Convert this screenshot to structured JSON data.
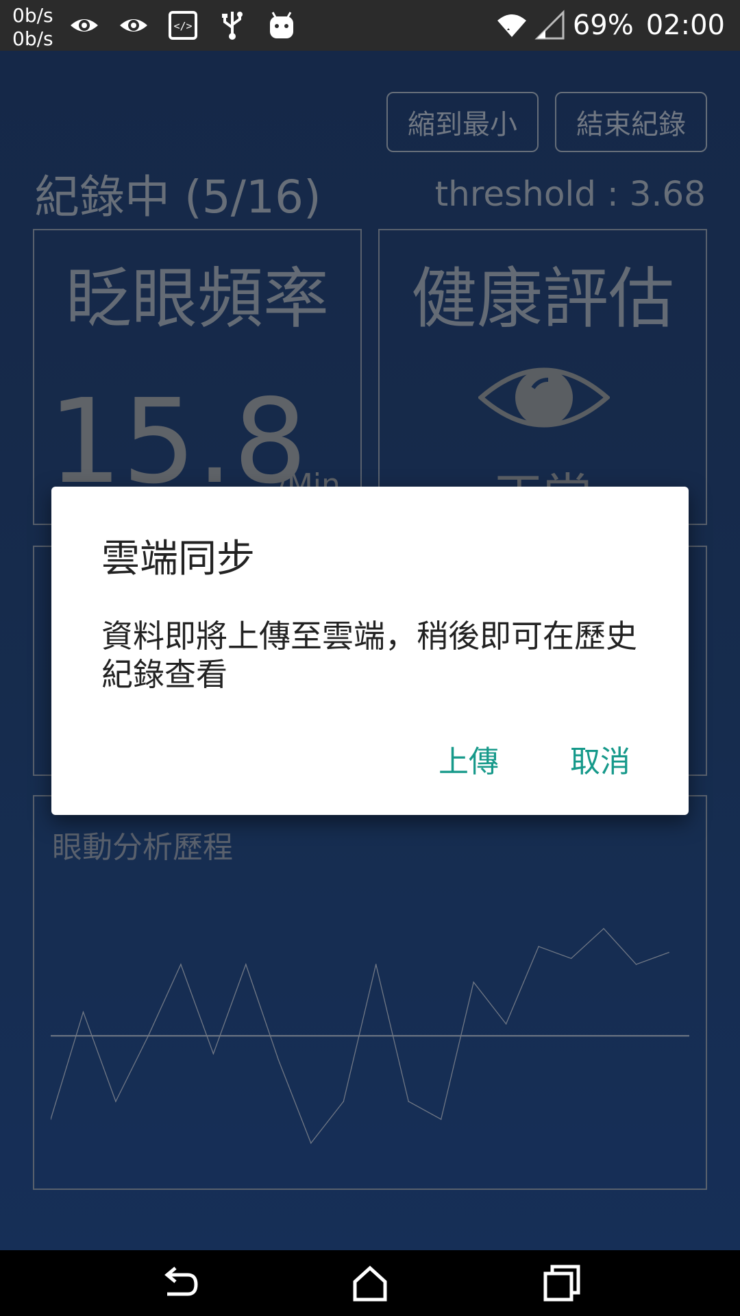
{
  "status_bar": {
    "net_up": "0b/s",
    "net_down": "0b/s",
    "battery": "69%",
    "time": "02:00",
    "icons": [
      "eye-icon",
      "eye-icon",
      "code-icon",
      "usb-icon",
      "android-icon",
      "wifi-icon",
      "signal-icon"
    ]
  },
  "header": {
    "minimize_label": "縮到最小",
    "end_label": "結束紀錄",
    "recording_status": "紀錄中 (5/16)",
    "threshold": "threshold : 3.68"
  },
  "panels": {
    "blink": {
      "title": "眨眼頻率",
      "value": "15.8",
      "unit": "/Min"
    },
    "health": {
      "title": "健康評估",
      "icon": "eye-icon",
      "label": "正常"
    }
  },
  "chart": {
    "label": "眼動分析歷程",
    "colors": {
      "line": "#8a93a3",
      "threshold": "#8e97a5"
    }
  },
  "chart_data": {
    "type": "line",
    "title": "眼動分析歷程",
    "xlabel": "",
    "ylabel": "",
    "series": [
      {
        "values": [
          3.0,
          4.8,
          3.3,
          4.4,
          5.6,
          4.1,
          5.6,
          4.0,
          2.6,
          3.3,
          5.6,
          3.3,
          3.0,
          5.3,
          4.6,
          5.9,
          5.7,
          6.2,
          5.6,
          5.8
        ]
      }
    ],
    "threshold": 4.4
  },
  "dialog": {
    "title": "雲端同步",
    "message": "資料即將上傳至雲端，稍後即可在歷史紀錄查看",
    "upload_label": "上傳",
    "cancel_label": "取消",
    "accent": "#16998a"
  },
  "nav_bar": {
    "icons": [
      "back-icon",
      "home-icon",
      "recents-icon"
    ]
  }
}
